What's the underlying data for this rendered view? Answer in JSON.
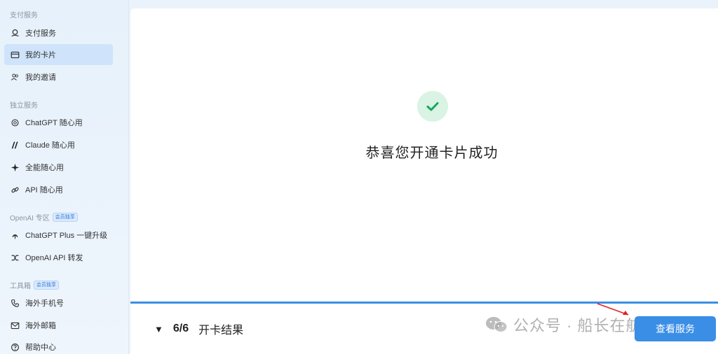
{
  "sidebar": {
    "sections": [
      {
        "label": "支付服务",
        "badge": ""
      },
      {
        "label": "独立服务",
        "badge": ""
      },
      {
        "label": "OpenAI 专区",
        "badge": "会员独享"
      },
      {
        "label": "工具箱",
        "badge": "会员独享"
      }
    ],
    "items": [
      {
        "label": "支付服务",
        "icon": "payment-icon"
      },
      {
        "label": "我的卡片",
        "icon": "card-icon"
      },
      {
        "label": "我的邀请",
        "icon": "users-icon"
      },
      {
        "label": "ChatGPT 随心用",
        "icon": "openai-icon"
      },
      {
        "label": "Claude 随心用",
        "icon": "claude-icon"
      },
      {
        "label": "全能随心用",
        "icon": "sparkle-icon"
      },
      {
        "label": "API 随心用",
        "icon": "link-icon"
      },
      {
        "label": "ChatGPT Plus 一键升级",
        "icon": "upgrade-icon"
      },
      {
        "label": "OpenAI API 转发",
        "icon": "shuffle-icon"
      },
      {
        "label": "海外手机号",
        "icon": "phone-icon"
      },
      {
        "label": "海外邮箱",
        "icon": "mail-icon"
      },
      {
        "label": "帮助中心",
        "icon": "help-icon"
      }
    ]
  },
  "main": {
    "success_title": "恭喜您开通卡片成功",
    "step_count": "6/6",
    "step_label": "开卡结果",
    "view_button": "查看服务"
  },
  "watermark": {
    "text": "公众号 · 船长在航行"
  },
  "colors": {
    "accent": "#3a8ee6",
    "success": "#1aa760",
    "active_bg": "#cfe4fb"
  }
}
